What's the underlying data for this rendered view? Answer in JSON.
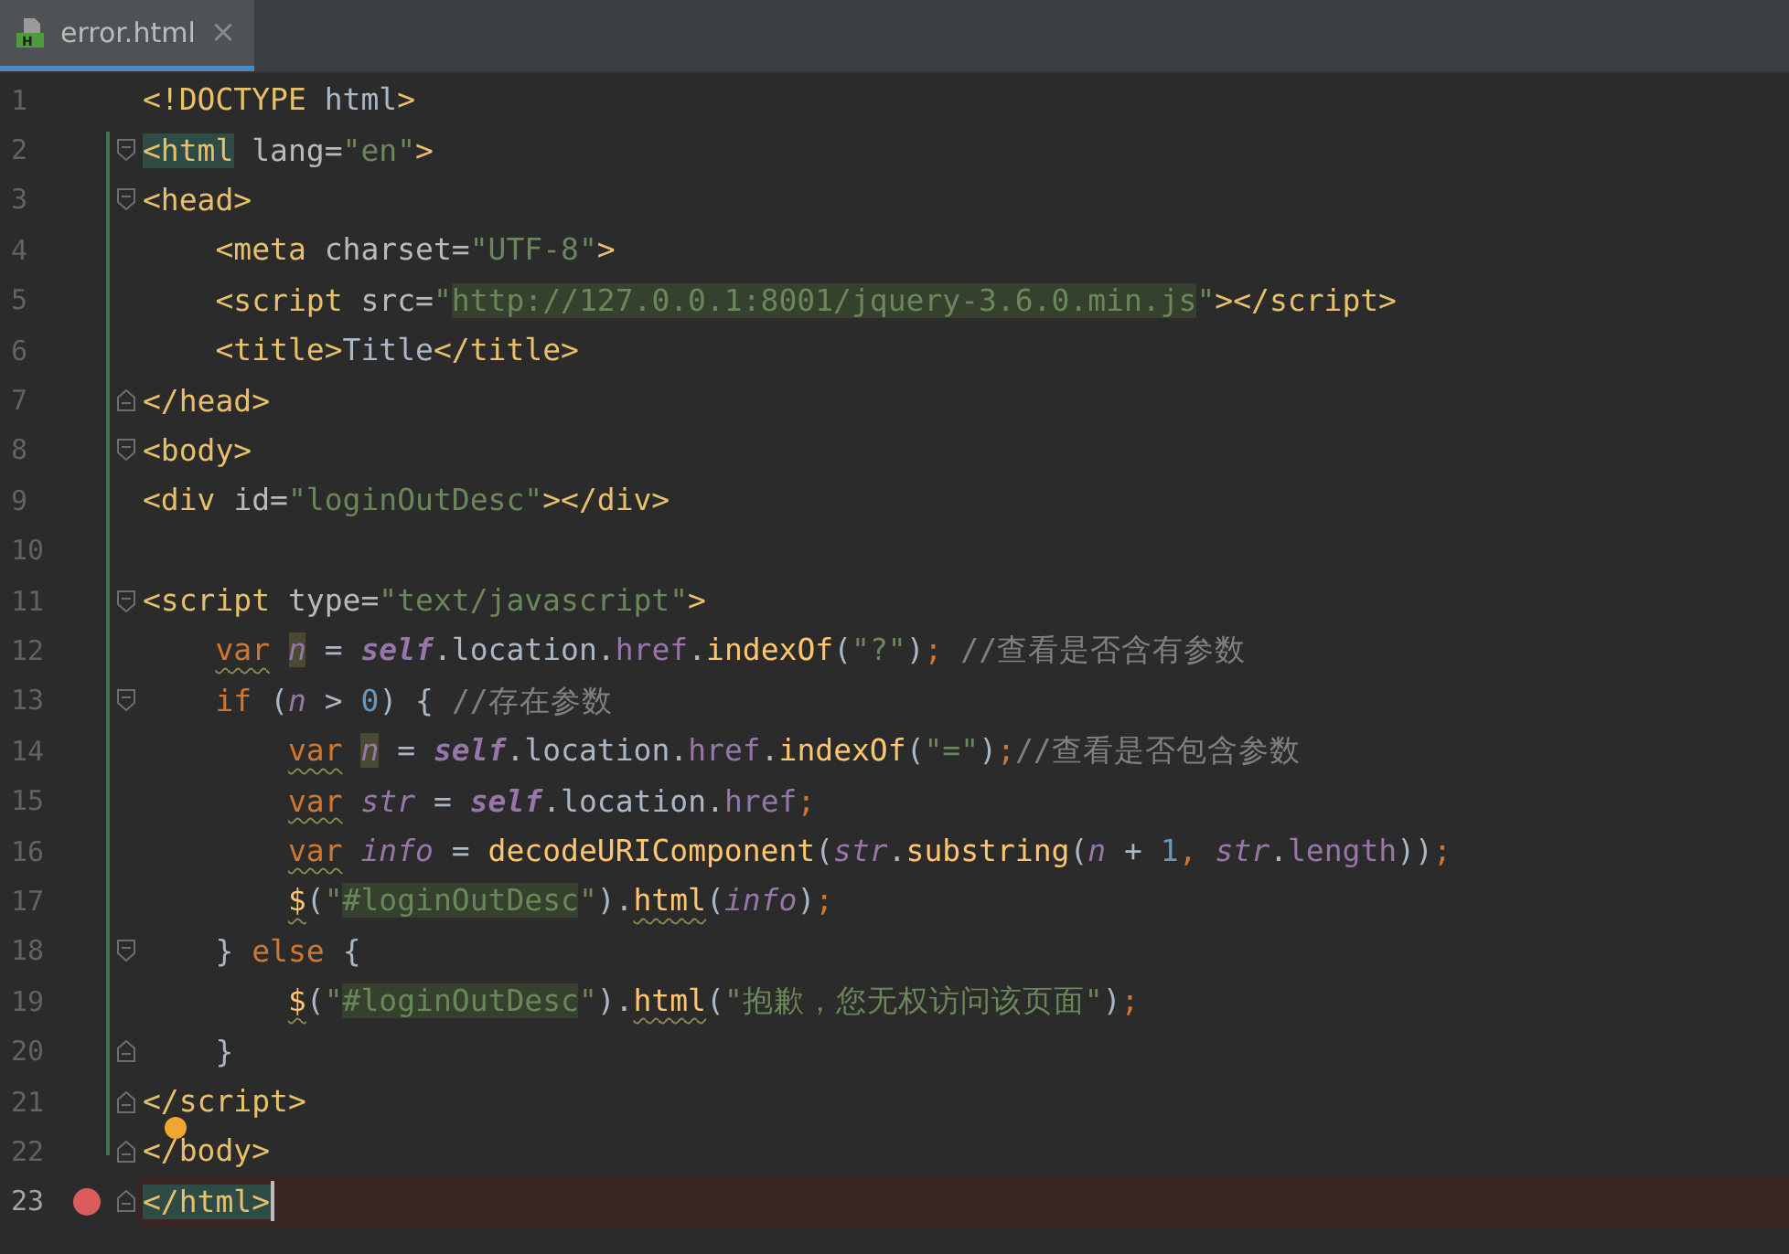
{
  "tabs": [
    {
      "label": "error.html",
      "icon_text": "H",
      "selected": true,
      "close": "×"
    }
  ],
  "lines": [
    {
      "number": "1",
      "tokens": [
        {
          "text": "<!DOCTYPE",
          "kind": "tag"
        },
        {
          "text": " html",
          "kind": "plain"
        },
        {
          "text": ">",
          "kind": "tag"
        }
      ]
    },
    {
      "number": "2",
      "fold_open": true,
      "tokens": [
        {
          "text": "<html",
          "kind": "tag",
          "highlighted": true
        },
        {
          "text": " lang=",
          "kind": "attr"
        },
        {
          "text": "\"en\"",
          "kind": "string"
        },
        {
          "text": ">",
          "kind": "tag"
        }
      ]
    },
    {
      "number": "3",
      "fold_open": true,
      "tokens": [
        {
          "text": "<head>",
          "kind": "tag"
        }
      ]
    },
    {
      "number": "4",
      "tokens": [
        {
          "text": "    <meta",
          "kind": "tag"
        },
        {
          "text": " charset=",
          "kind": "attr"
        },
        {
          "text": "\"UTF-8\"",
          "kind": "string"
        },
        {
          "text": ">",
          "kind": "tag"
        }
      ]
    },
    {
      "number": "5",
      "tokens": [
        {
          "text": "    <script",
          "kind": "tag"
        },
        {
          "text": " src=",
          "kind": "attr"
        },
        {
          "text": "\"",
          "kind": "string"
        },
        {
          "text": "http://127.0.0.1:8001/jquery-3.6.0.min.js",
          "kind": "string",
          "highlighted": true
        },
        {
          "text": "\"",
          "kind": "string"
        },
        {
          "text": "></script>",
          "kind": "tag"
        }
      ]
    },
    {
      "number": "6",
      "tokens": [
        {
          "text": "    <title>",
          "kind": "tag"
        },
        {
          "text": "Title",
          "kind": "plain"
        },
        {
          "text": "</title>",
          "kind": "tag"
        }
      ]
    },
    {
      "number": "7",
      "fold_close": true,
      "tokens": [
        {
          "text": "</head>",
          "kind": "tag"
        }
      ]
    },
    {
      "number": "8",
      "fold_open": true,
      "tokens": [
        {
          "text": "<body>",
          "kind": "tag"
        }
      ]
    },
    {
      "number": "9",
      "tokens": [
        {
          "text": "<div",
          "kind": "tag"
        },
        {
          "text": " id=",
          "kind": "attr"
        },
        {
          "text": "\"loginOutDesc\"",
          "kind": "string"
        },
        {
          "text": "></div>",
          "kind": "tag"
        }
      ]
    },
    {
      "number": "10"
    },
    {
      "number": "11",
      "fold_open": true,
      "tokens": [
        {
          "text": "<script",
          "kind": "tag"
        },
        {
          "text": " type=",
          "kind": "attr"
        },
        {
          "text": "\"text/javascript\"",
          "kind": "string"
        },
        {
          "text": ">",
          "kind": "tag"
        }
      ]
    },
    {
      "number": "12",
      "tokens": [
        {
          "text": "    var ",
          "kind": "keyword",
          "wavy": true
        },
        {
          "text": "n",
          "kind": "local",
          "highlighted": true
        },
        {
          "text": " = ",
          "kind": "plain"
        },
        {
          "text": "self",
          "kind": "global"
        },
        {
          "text": ".location.",
          "kind": "plain"
        },
        {
          "text": "href",
          "kind": "property"
        },
        {
          "text": ".",
          "kind": "plain"
        },
        {
          "text": "indexOf",
          "kind": "function"
        },
        {
          "text": "(",
          "kind": "plain"
        },
        {
          "text": "\"?\"",
          "kind": "string"
        },
        {
          "text": ")",
          "kind": "plain"
        },
        {
          "text": ";",
          "kind": "keyword"
        },
        {
          "text": " //查看是否含有参数",
          "kind": "comment"
        }
      ]
    },
    {
      "number": "13",
      "fold_open": true,
      "tokens": [
        {
          "text": "    if",
          "kind": "keyword"
        },
        {
          "text": " (",
          "kind": "plain"
        },
        {
          "text": "n",
          "kind": "local"
        },
        {
          "text": " > ",
          "kind": "plain"
        },
        {
          "text": "0",
          "kind": "number"
        },
        {
          "text": ") { ",
          "kind": "plain"
        },
        {
          "text": "//存在参数",
          "kind": "comment"
        }
      ]
    },
    {
      "number": "14",
      "tokens": [
        {
          "text": "        var ",
          "kind": "keyword",
          "wavy": true
        },
        {
          "text": "n",
          "kind": "local",
          "highlighted": true
        },
        {
          "text": " = ",
          "kind": "plain"
        },
        {
          "text": "self",
          "kind": "global"
        },
        {
          "text": ".location.",
          "kind": "plain"
        },
        {
          "text": "href",
          "kind": "property"
        },
        {
          "text": ".",
          "kind": "plain"
        },
        {
          "text": "indexOf",
          "kind": "function"
        },
        {
          "text": "(",
          "kind": "plain"
        },
        {
          "text": "\"=\"",
          "kind": "string"
        },
        {
          "text": ")",
          "kind": "plain"
        },
        {
          "text": ";",
          "kind": "keyword"
        },
        {
          "text": "//查看是否包含参数",
          "kind": "comment"
        }
      ]
    },
    {
      "number": "15",
      "tokens": [
        {
          "text": "        var ",
          "kind": "keyword",
          "wavy": true
        },
        {
          "text": "str",
          "kind": "local"
        },
        {
          "text": " = ",
          "kind": "plain"
        },
        {
          "text": "self",
          "kind": "global"
        },
        {
          "text": ".location.",
          "kind": "plain"
        },
        {
          "text": "href",
          "kind": "property"
        },
        {
          "text": ";",
          "kind": "keyword"
        }
      ]
    },
    {
      "number": "16",
      "tokens": [
        {
          "text": "        var ",
          "kind": "keyword",
          "wavy": true
        },
        {
          "text": "info",
          "kind": "local"
        },
        {
          "text": " = ",
          "kind": "plain"
        },
        {
          "text": "decodeURIComponent",
          "kind": "function"
        },
        {
          "text": "(",
          "kind": "plain"
        },
        {
          "text": "str",
          "kind": "local"
        },
        {
          "text": ".",
          "kind": "plain"
        },
        {
          "text": "substring",
          "kind": "function"
        },
        {
          "text": "(",
          "kind": "plain"
        },
        {
          "text": "n",
          "kind": "local"
        },
        {
          "text": " + ",
          "kind": "plain"
        },
        {
          "text": "1",
          "kind": "number"
        },
        {
          "text": ", ",
          "kind": "keyword"
        },
        {
          "text": "str",
          "kind": "local"
        },
        {
          "text": ".",
          "kind": "plain"
        },
        {
          "text": "length",
          "kind": "property"
        },
        {
          "text": "))",
          "kind": "plain"
        },
        {
          "text": ";",
          "kind": "keyword"
        }
      ]
    },
    {
      "number": "17",
      "tokens": [
        {
          "text": "        $",
          "kind": "function",
          "wavy": true
        },
        {
          "text": "(",
          "kind": "plain"
        },
        {
          "text": "\"",
          "kind": "string"
        },
        {
          "text": "#loginOutDesc",
          "kind": "string",
          "highlighted": true
        },
        {
          "text": "\"",
          "kind": "string"
        },
        {
          "text": ").",
          "kind": "plain"
        },
        {
          "text": "html",
          "kind": "function",
          "wavy": true
        },
        {
          "text": "(",
          "kind": "plain"
        },
        {
          "text": "info",
          "kind": "local"
        },
        {
          "text": ")",
          "kind": "plain"
        },
        {
          "text": ";",
          "kind": "keyword"
        }
      ]
    },
    {
      "number": "18",
      "fold_open": true,
      "tokens": [
        {
          "text": "    } ",
          "kind": "plain"
        },
        {
          "text": "else",
          "kind": "keyword"
        },
        {
          "text": " {",
          "kind": "plain"
        }
      ]
    },
    {
      "number": "19",
      "tokens": [
        {
          "text": "        $",
          "kind": "function",
          "wavy": true
        },
        {
          "text": "(",
          "kind": "plain"
        },
        {
          "text": "\"",
          "kind": "string"
        },
        {
          "text": "#loginOutDesc",
          "kind": "string",
          "highlighted": true
        },
        {
          "text": "\"",
          "kind": "string"
        },
        {
          "text": ").",
          "kind": "plain"
        },
        {
          "text": "html",
          "kind": "function",
          "wavy": true
        },
        {
          "text": "(",
          "kind": "plain"
        },
        {
          "text": "\"抱歉，您无权访问该页面\"",
          "kind": "string"
        },
        {
          "text": ")",
          "kind": "plain"
        },
        {
          "text": ";",
          "kind": "keyword"
        }
      ]
    },
    {
      "number": "20",
      "fold_close": true,
      "tokens": [
        {
          "text": "    }",
          "kind": "plain"
        }
      ]
    },
    {
      "number": "21",
      "fold_close": true,
      "tokens": [
        {
          "text": "</script>",
          "kind": "tag"
        }
      ]
    },
    {
      "number": "22",
      "fold_close": true,
      "bulb": true,
      "tokens": [
        {
          "text": "</body>",
          "kind": "tag"
        }
      ]
    },
    {
      "number": "23",
      "fold_close": true,
      "breakpoint": true,
      "current": true,
      "caret": true,
      "tokens": [
        {
          "text": "</html>",
          "kind": "tag",
          "highlighted": true
        }
      ]
    }
  ]
}
